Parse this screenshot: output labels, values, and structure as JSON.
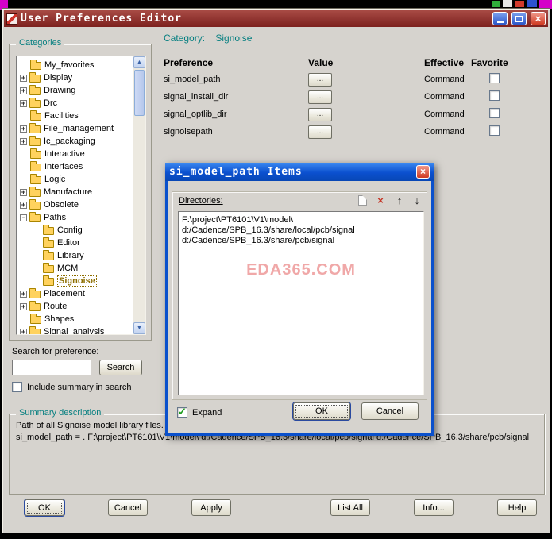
{
  "window": {
    "title": "User Preferences Editor"
  },
  "icons": {
    "close_x": "×",
    "delete_x": "×",
    "arrow_up": "↑",
    "arrow_down": "↓",
    "scroll_up": "▲",
    "scroll_down": "▼",
    "check": "✓"
  },
  "categories_panel": {
    "label": "Categories",
    "tree": [
      {
        "label": "My_favorites",
        "expander": "",
        "depth": 1
      },
      {
        "label": "Display",
        "expander": "+",
        "depth": 1
      },
      {
        "label": "Drawing",
        "expander": "+",
        "depth": 1
      },
      {
        "label": "Drc",
        "expander": "+",
        "depth": 1
      },
      {
        "label": "Facilities",
        "expander": "",
        "depth": 1
      },
      {
        "label": "File_management",
        "expander": "+",
        "depth": 1
      },
      {
        "label": "Ic_packaging",
        "expander": "+",
        "depth": 1
      },
      {
        "label": "Interactive",
        "expander": "",
        "depth": 1
      },
      {
        "label": "Interfaces",
        "expander": "",
        "depth": 1
      },
      {
        "label": "Logic",
        "expander": "",
        "depth": 1
      },
      {
        "label": "Manufacture",
        "expander": "+",
        "depth": 1
      },
      {
        "label": "Obsolete",
        "expander": "+",
        "depth": 1
      },
      {
        "label": "Paths",
        "expander": "-",
        "depth": 1
      },
      {
        "label": "Config",
        "expander": "",
        "depth": 2
      },
      {
        "label": "Editor",
        "expander": "",
        "depth": 2
      },
      {
        "label": "Library",
        "expander": "",
        "depth": 2
      },
      {
        "label": "MCM",
        "expander": "",
        "depth": 2
      },
      {
        "label": "Signoise",
        "expander": "",
        "depth": 2,
        "selected": true
      },
      {
        "label": "Placement",
        "expander": "+",
        "depth": 1
      },
      {
        "label": "Route",
        "expander": "+",
        "depth": 1
      },
      {
        "label": "Shapes",
        "expander": "",
        "depth": 1
      },
      {
        "label": "Signal_analysis",
        "expander": "+",
        "depth": 1
      }
    ],
    "search_label": "Search for preference:",
    "search_value": "",
    "search_button": "Search",
    "include_summary_label": "Include summary in search",
    "include_summary_checked": false
  },
  "category_panel": {
    "label": "Category:",
    "value": "Signoise",
    "columns": [
      "Preference",
      "Value",
      "Effective",
      "Favorite"
    ],
    "rows": [
      {
        "preference": "si_model_path",
        "value_button": "...",
        "effective": "Command",
        "favorite": false
      },
      {
        "preference": "signal_install_dir",
        "value_button": "...",
        "effective": "Command",
        "favorite": false
      },
      {
        "preference": "signal_optlib_dir",
        "value_button": "...",
        "effective": "Command",
        "favorite": false
      },
      {
        "preference": "signoisepath",
        "value_button": "...",
        "effective": "Command",
        "favorite": false
      }
    ]
  },
  "summary_panel": {
    "label": "Summary description",
    "description": "Path of all Signoise model library files.",
    "value_text": "si_model_path = . F:\\project\\PT6101\\V1\\model\\ d:/Cadence/SPB_16.3/share/local/pcb/signal d:/Cadence/SPB_16.3/share/pcb/signal"
  },
  "footer": {
    "buttons": [
      "OK",
      "Cancel",
      "Apply",
      "List All",
      "Info...",
      "Help"
    ]
  },
  "items_dialog": {
    "title": "si_model_path Items",
    "directories_label": "Directories:",
    "toolbar_icons": [
      "new-item",
      "delete",
      "move-up",
      "move-down"
    ],
    "items": [
      "F:\\project\\PT6101\\V1\\model\\",
      "d:/Cadence/SPB_16.3/share/local/pcb/signal",
      "d:/Cadence/SPB_16.3/share/pcb/signal"
    ],
    "watermark": "EDA365.COM",
    "expand_label": "Expand",
    "expand_checked": true,
    "ok_button": "OK",
    "cancel_button": "Cancel"
  }
}
